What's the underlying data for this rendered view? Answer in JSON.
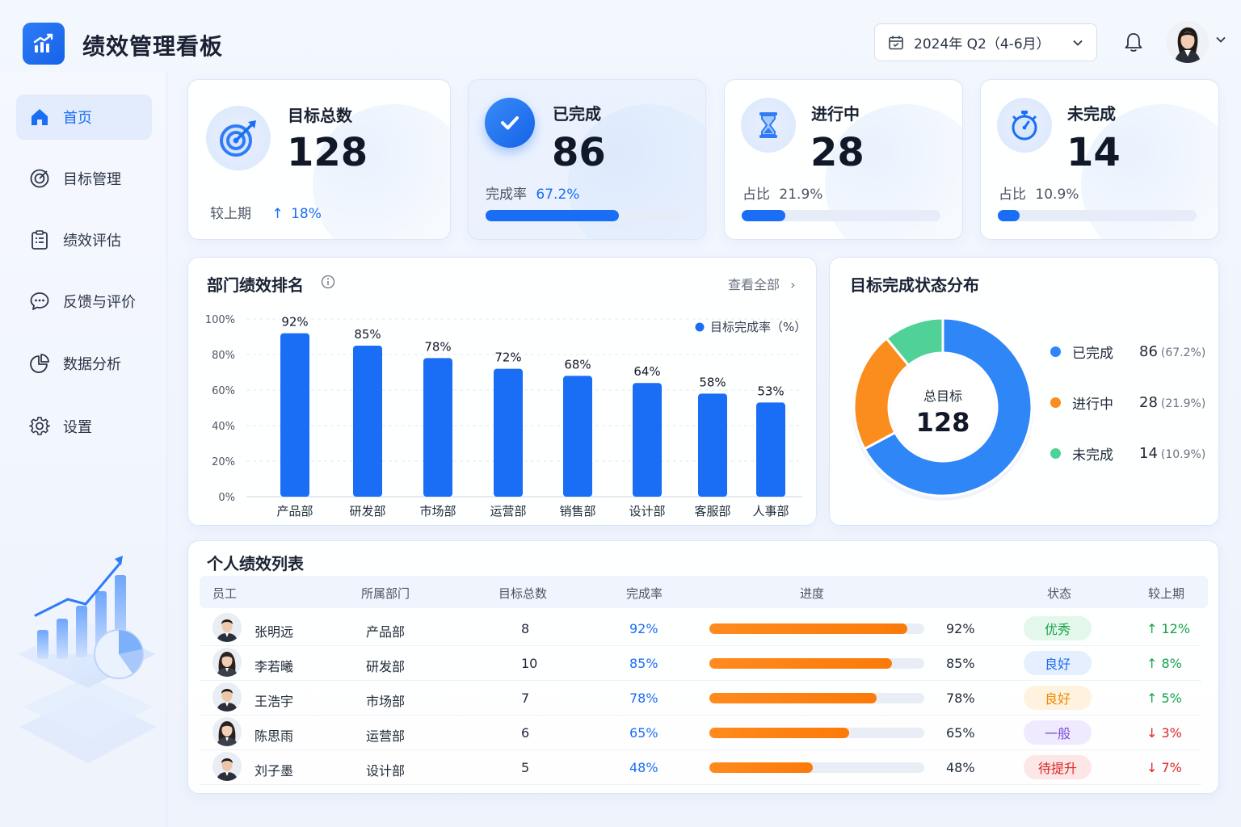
{
  "header": {
    "title": "绩效管理看板",
    "date_range": "2024年 Q2（4-6月）"
  },
  "sidebar": {
    "items": [
      {
        "label": "首页",
        "icon": "home-icon",
        "active": true
      },
      {
        "label": "目标管理",
        "icon": "target-icon",
        "active": false
      },
      {
        "label": "绩效评估",
        "icon": "clipboard-icon",
        "active": false
      },
      {
        "label": "反馈与评价",
        "icon": "chat-icon",
        "active": false
      },
      {
        "label": "数据分析",
        "icon": "pie-chart-icon",
        "active": false
      },
      {
        "label": "设置",
        "icon": "gear-icon",
        "active": false
      }
    ]
  },
  "stats": {
    "total": {
      "title": "目标总数",
      "value": "128",
      "compare_label": "较上期",
      "compare_value": "18%"
    },
    "done": {
      "title": "已完成",
      "value": "86",
      "sub_label": "完成率",
      "sub_value": "67.2%",
      "progress": 0.672
    },
    "inprogress": {
      "title": "进行中",
      "value": "28",
      "sub_label": "占比",
      "sub_value": "21.9%",
      "progress": 0.219
    },
    "notdone": {
      "title": "未完成",
      "value": "14",
      "sub_label": "占比",
      "sub_value": "10.9%",
      "progress": 0.109
    }
  },
  "dept_panel": {
    "title": "部门绩效排名",
    "view_all": "查看全部"
  },
  "status_panel": {
    "title": "目标完成状态分布",
    "center_label": "总目标",
    "center_value": "128"
  },
  "chart_data": [
    {
      "type": "bar",
      "categories": [
        "产品部",
        "研发部",
        "市场部",
        "运营部",
        "销售部",
        "设计部",
        "客服部",
        "人事部"
      ],
      "series": [
        {
          "name": "目标完成率（%）",
          "values": [
            92,
            85,
            78,
            72,
            68,
            64,
            58,
            53
          ]
        }
      ],
      "value_labels": [
        "92%",
        "85%",
        "78%",
        "72%",
        "68%",
        "64%",
        "58%",
        "53%"
      ],
      "yticks": [
        "100%",
        "80%",
        "60%",
        "40%",
        "20%",
        "0%"
      ],
      "ylim": [
        0,
        100
      ],
      "grid": true,
      "legend_position": "top-right",
      "color": "#1a6ef5"
    },
    {
      "type": "pie",
      "categories": [
        "已完成",
        "进行中",
        "未完成"
      ],
      "values": [
        86,
        28,
        14
      ],
      "percent_labels": [
        "(67.2%)",
        "(21.9%)",
        "(10.9%)"
      ],
      "colors": [
        "#2f86f6",
        "#fb8c1e",
        "#4fd197"
      ],
      "legend_position": "right"
    }
  ],
  "table": {
    "title": "个人绩效列表",
    "columns": [
      "员工",
      "所属部门",
      "目标总数",
      "完成率",
      "进度",
      "状态",
      "较上期"
    ],
    "rows": [
      {
        "name": "张明远",
        "dept": "产品部",
        "goals": "8",
        "rate": "92%",
        "progress": 0.92,
        "progress_label": "92%",
        "status": "优秀",
        "trend": "↑ 12%",
        "dir": "up",
        "badge_bg": "#e3f7ea",
        "badge_fg": "#16a34a"
      },
      {
        "name": "李若曦",
        "dept": "研发部",
        "goals": "10",
        "rate": "85%",
        "progress": 0.85,
        "progress_label": "85%",
        "status": "良好",
        "trend": "↑ 8%",
        "dir": "up",
        "badge_bg": "#e6effd",
        "badge_fg": "#1a6ef5"
      },
      {
        "name": "王浩宇",
        "dept": "市场部",
        "goals": "7",
        "rate": "78%",
        "progress": 0.78,
        "progress_label": "78%",
        "status": "良好",
        "trend": "↑ 5%",
        "dir": "up",
        "badge_bg": "#fff3df",
        "badge_fg": "#f08a00"
      },
      {
        "name": "陈思雨",
        "dept": "运营部",
        "goals": "6",
        "rate": "65%",
        "progress": 0.65,
        "progress_label": "65%",
        "status": "一般",
        "trend": "↓ 3%",
        "dir": "down",
        "badge_bg": "#efeafd",
        "badge_fg": "#7c4ddb"
      },
      {
        "name": "刘子墨",
        "dept": "设计部",
        "goals": "5",
        "rate": "48%",
        "progress": 0.48,
        "progress_label": "48%",
        "status": "待提升",
        "trend": "↓ 7%",
        "dir": "down",
        "badge_bg": "#fde6e6",
        "badge_fg": "#dc2626"
      }
    ]
  }
}
